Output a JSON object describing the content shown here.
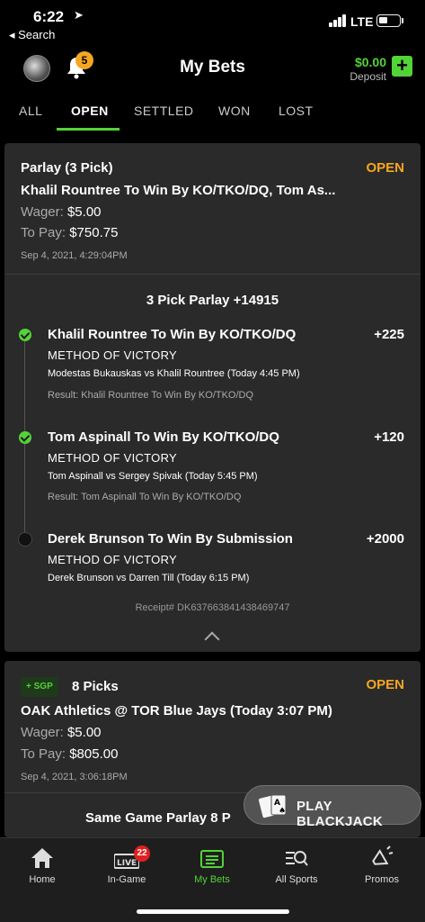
{
  "status_bar": {
    "time": "6:22",
    "back_label": "◂ Search",
    "network": "LTE"
  },
  "header": {
    "title": "My Bets",
    "notification_count": "5",
    "balance": "$0.00",
    "deposit_label": "Deposit",
    "add_label": "+"
  },
  "tabs": [
    "ALL",
    "OPEN",
    "SETTLED",
    "WON",
    "LOST"
  ],
  "active_tab": "OPEN",
  "bets": [
    {
      "type": "Parlay (3 Pick)",
      "status": "OPEN",
      "title": "Khalil Rountree To Win By KO/TKO/DQ, Tom As...",
      "wager_label": "Wager:",
      "wager": "$5.00",
      "to_pay_label": "To Pay:",
      "to_pay": "$750.75",
      "placed": "Sep 4, 2021, 4:29:04PM",
      "parlay_header": "3 Pick Parlay +14915",
      "legs": [
        {
          "title": "Khalil Rountree To Win By KO/TKO/DQ",
          "odds": "+225",
          "market": "METHOD OF VICTORY",
          "event": "Modestas Bukauskas vs Khalil Rountree (Today 4:45 PM)",
          "result": "Result: Khalil Rountree To Win By KO/TKO/DQ",
          "state": "won"
        },
        {
          "title": "Tom Aspinall To Win By KO/TKO/DQ",
          "odds": "+120",
          "market": "METHOD OF VICTORY",
          "event": "Tom Aspinall vs Sergey Spivak (Today 5:45 PM)",
          "result": "Result: Tom Aspinall To Win By KO/TKO/DQ",
          "state": "won"
        },
        {
          "title": "Derek Brunson To Win By Submission",
          "odds": "+2000",
          "market": "METHOD OF VICTORY",
          "event": "Derek Brunson vs Darren Till (Today 6:15 PM)",
          "result": "",
          "state": "pending"
        }
      ],
      "receipt": "Receipt# DK637663841438469747"
    },
    {
      "badge": "+ SGP",
      "type": "8 Picks",
      "status": "OPEN",
      "title": "OAK Athletics @ TOR Blue Jays (Today 3:07 PM)",
      "wager_label": "Wager:",
      "wager": "$5.00",
      "to_pay_label": "To Pay:",
      "to_pay": "$805.00",
      "placed": "Sep 4, 2021, 3:06:18PM",
      "parlay_header": "Same Game Parlay 8 P"
    }
  ],
  "floating_button": {
    "label": "PLAY BLACKJACK"
  },
  "bottom_nav": [
    {
      "label": "Home",
      "icon": "home-icon"
    },
    {
      "label": "In-Game",
      "icon": "live-icon",
      "badge": "22",
      "icon_text": "LIVE"
    },
    {
      "label": "My Bets",
      "icon": "receipt-icon"
    },
    {
      "label": "All Sports",
      "icon": "list-search-icon"
    },
    {
      "label": "Promos",
      "icon": "megaphone-icon"
    }
  ],
  "colors": {
    "accent": "#53d337",
    "open": "#f5a623",
    "card": "#2a2a2a",
    "background": "#000000"
  }
}
